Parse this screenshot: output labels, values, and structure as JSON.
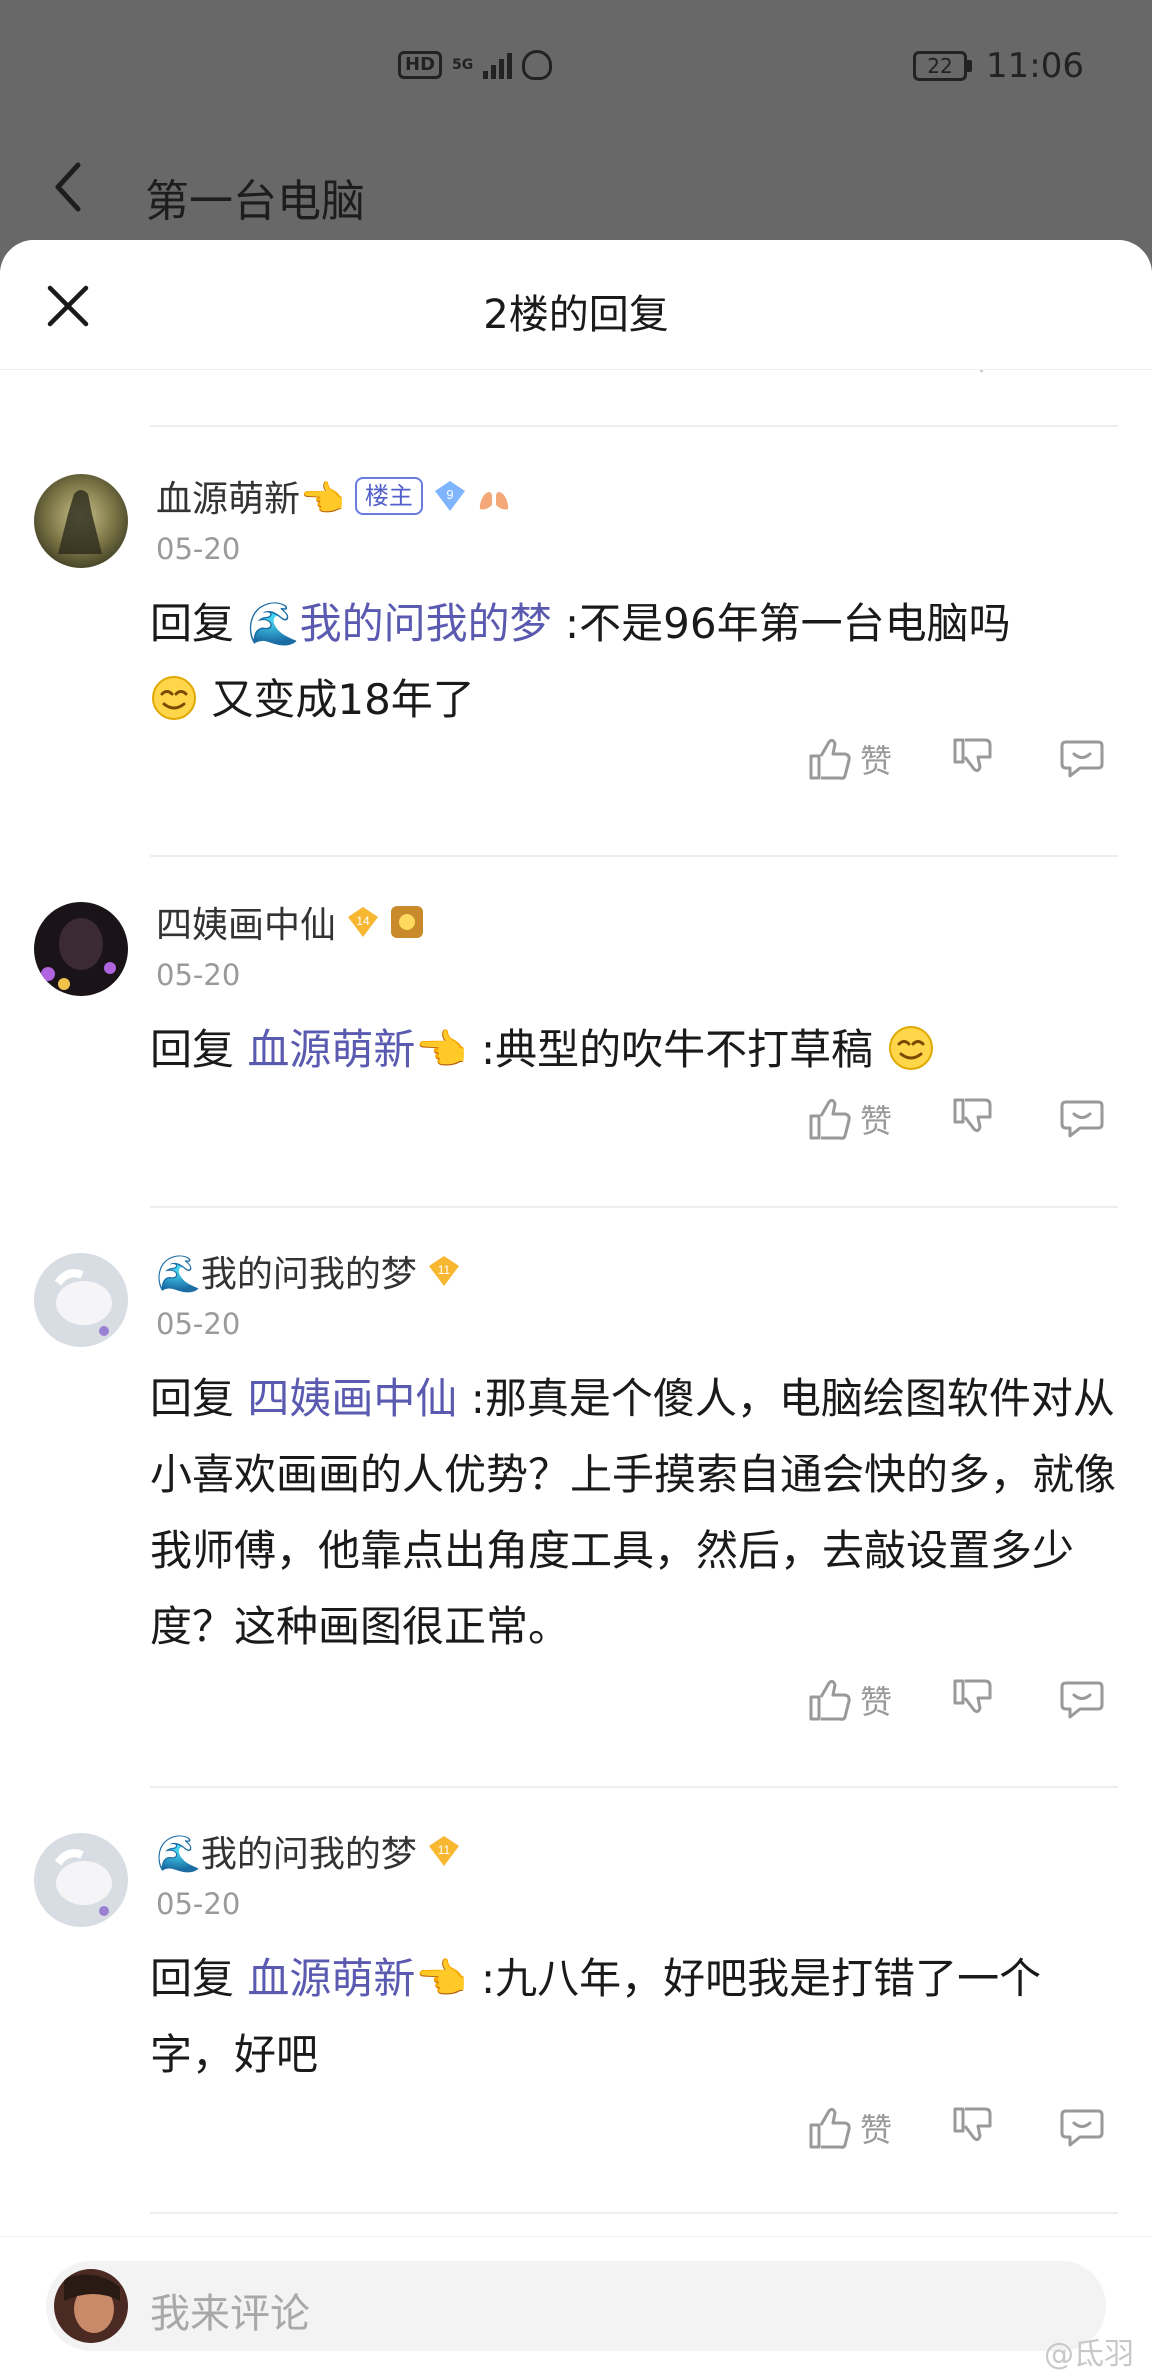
{
  "status_bar": {
    "hd": "HD",
    "net": "5G",
    "battery": "22",
    "time": "11:06"
  },
  "page": {
    "title": "第一台电脑"
  },
  "sheet": {
    "title": "2楼的回复"
  },
  "comments": [
    {
      "name": "血源萌新👈",
      "host_badge": "楼主",
      "level": "9",
      "date": "05-20",
      "reply_prefix": "回复",
      "mention": "🌊我的问我的梦",
      "text": ":不是96年第一台电脑吗",
      "text2": "又变成18年了",
      "like_label": "赞"
    },
    {
      "name": "四姨画中仙",
      "level": "14",
      "date": "05-20",
      "reply_prefix": "回复",
      "mention": "血源萌新👈",
      "text": ":典型的吹牛不打草稿",
      "like_label": "赞"
    },
    {
      "name": "🌊我的问我的梦",
      "level": "11",
      "date": "05-20",
      "reply_prefix": "回复",
      "mention": "四姨画中仙",
      "text": ":那真是个傻人，电脑绘图软件对从小喜欢画画的人优势？上手摸索自通会快的多，就像我师傅，他靠点出角度工具，然后，去敲设置多少度？这种画图很正常。",
      "like_label": "赞"
    },
    {
      "name": "🌊我的问我的梦",
      "level": "11",
      "date": "05-20",
      "reply_prefix": "回复",
      "mention": "血源萌新👈",
      "text": ":九八年，好吧我是打错了一个字，好吧",
      "like_label": "赞"
    }
  ],
  "input": {
    "placeholder": "我来评论"
  },
  "watermark": "@氐羽"
}
